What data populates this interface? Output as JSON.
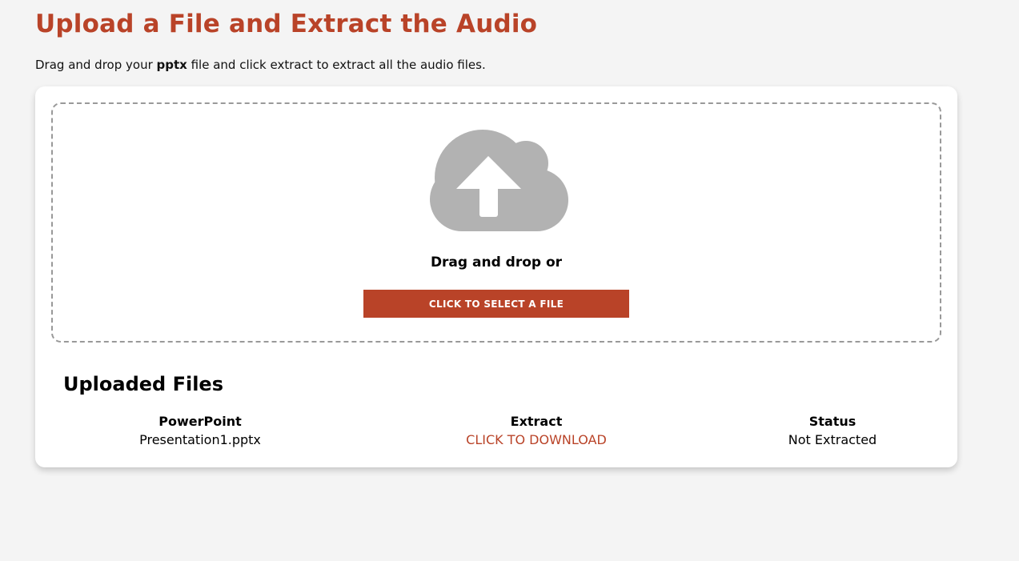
{
  "header": {
    "title": "Upload a File and Extract the Audio",
    "intro_before": "Drag and drop your ",
    "intro_bold": "pptx",
    "intro_after": " file and click extract to extract all the audio files."
  },
  "dropzone": {
    "icon": "cloud-upload-icon",
    "prompt": "Drag and drop or",
    "button_label": "CLICK TO SELECT A FILE"
  },
  "uploaded": {
    "title": "Uploaded Files",
    "columns": [
      "PowerPoint",
      "Extract",
      "Status"
    ],
    "rows": [
      {
        "file": "Presentation1.pptx",
        "extract": "CLICK TO DOWNLOAD",
        "status": "Not Extracted"
      }
    ]
  },
  "colors": {
    "accent": "#b94328",
    "background": "#f4f4f4",
    "icon_gray": "#b2b2b2"
  }
}
